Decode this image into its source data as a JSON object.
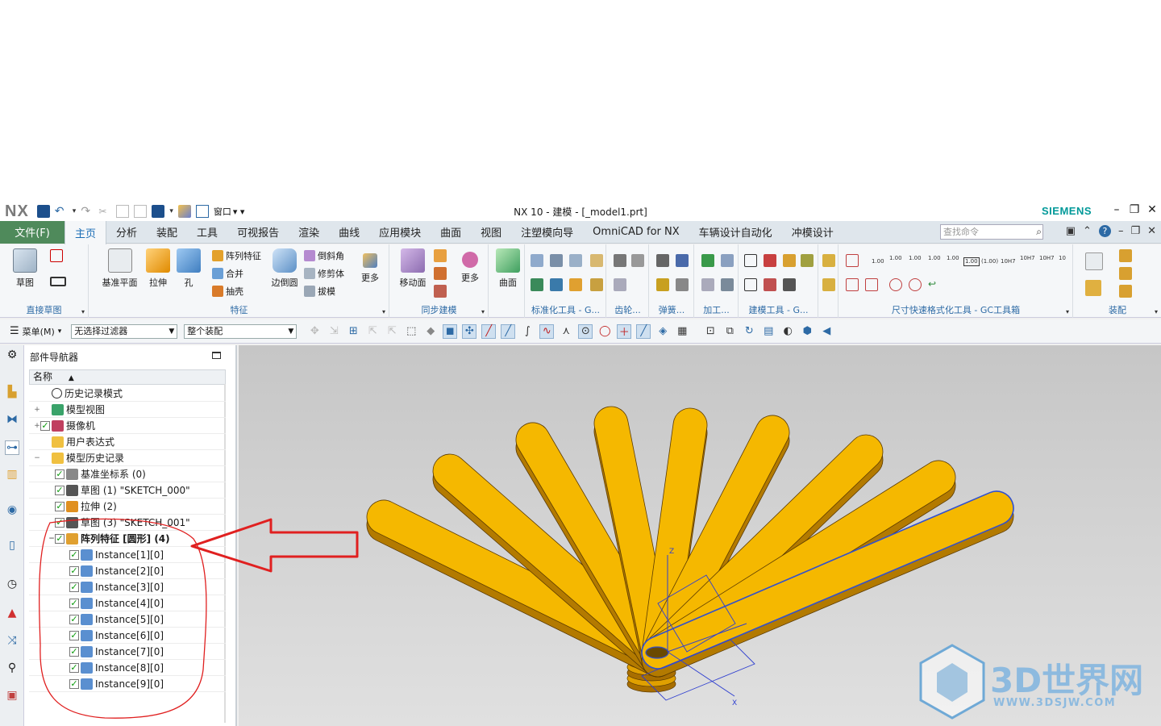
{
  "app": {
    "logo": "NX",
    "window_menu_label": "窗口",
    "title": "NX 10 - 建模 - [_model1.prt]",
    "brand": "SIEMENS"
  },
  "tabs": {
    "file": "文件(F)",
    "items": [
      "主页",
      "分析",
      "装配",
      "工具",
      "可视报告",
      "渲染",
      "曲线",
      "应用模块",
      "曲面",
      "视图",
      "注塑模向导",
      "OmniCAD for NX",
      "车辆设计自动化",
      "冲模设计"
    ],
    "active": "主页",
    "search_placeholder": "查找命令"
  },
  "ribbon": {
    "sketch": {
      "label": "草图",
      "group": "直接草图"
    },
    "feature": {
      "datum_plane": "基准平面",
      "extrude": "拉伸",
      "hole": "孔",
      "pattern": "阵列特征",
      "unite": "合并",
      "shell": "抽壳",
      "edge_blend": "边倒圆",
      "chamfer": "倒斜角",
      "trim_body": "修剪体",
      "draft": "拔模",
      "more": "更多",
      "group": "特征"
    },
    "sync": {
      "move_face": "移动面",
      "more": "更多",
      "group": "同步建模"
    },
    "surface": {
      "label": "曲面"
    },
    "groups": {
      "std_tools": "标准化工具 - G...",
      "gear": "齿轮...",
      "spring": "弹簧...",
      "machining": "加工...",
      "modeling_tools": "建模工具 - G...",
      "dim": "尺寸快速格式化工具 - GC工具箱",
      "assembly": "装配"
    },
    "tolerance_labels": [
      "1.00",
      "1.00",
      "1.00",
      "1.00",
      "1.00",
      "1.00",
      "(1.00)",
      "10H7",
      "10H7",
      "10H7",
      "10"
    ]
  },
  "toolbar2": {
    "menu": "菜单(M)",
    "filter": "无选择过滤器",
    "scope": "整个装配"
  },
  "navigator": {
    "title": "部件导航器",
    "column": "名称",
    "rows": [
      {
        "label": "历史记录模式",
        "indent": 0,
        "check": false,
        "icon": "clock-icon"
      },
      {
        "label": "模型视图",
        "indent": 0,
        "check": false,
        "icon": "view-icon",
        "expander": "+"
      },
      {
        "label": "摄像机",
        "indent": 0,
        "check": true,
        "icon": "camera-icon",
        "expander": "+"
      },
      {
        "label": "用户表达式",
        "indent": 0,
        "check": false,
        "icon": "folder-icon"
      },
      {
        "label": "模型历史记录",
        "indent": 0,
        "check": false,
        "icon": "folder-icon",
        "expander": "−"
      },
      {
        "label": "基准坐标系 (0)",
        "indent": 1,
        "check": true,
        "icon": "csys-icon"
      },
      {
        "label": "草图 (1) \"SKETCH_000\"",
        "indent": 1,
        "check": true,
        "icon": "sketch-icon"
      },
      {
        "label": "拉伸 (2)",
        "indent": 1,
        "check": true,
        "icon": "extrude-icon"
      },
      {
        "label": "草图 (3) \"SKETCH_001\"",
        "indent": 1,
        "check": true,
        "icon": "sketch-icon"
      },
      {
        "label": "阵列特征 [圆形] (4)",
        "indent": 1,
        "check": true,
        "icon": "pattern-icon",
        "bold": true,
        "expander": "−"
      },
      {
        "label": "Instance[1][0]",
        "indent": 2,
        "check": true,
        "icon": "instance-icon"
      },
      {
        "label": "Instance[2][0]",
        "indent": 2,
        "check": true,
        "icon": "instance-icon"
      },
      {
        "label": "Instance[3][0]",
        "indent": 2,
        "check": true,
        "icon": "instance-icon"
      },
      {
        "label": "Instance[4][0]",
        "indent": 2,
        "check": true,
        "icon": "instance-icon"
      },
      {
        "label": "Instance[5][0]",
        "indent": 2,
        "check": true,
        "icon": "instance-icon"
      },
      {
        "label": "Instance[6][0]",
        "indent": 2,
        "check": true,
        "icon": "instance-icon"
      },
      {
        "label": "Instance[7][0]",
        "indent": 2,
        "check": true,
        "icon": "instance-icon"
      },
      {
        "label": "Instance[8][0]",
        "indent": 2,
        "check": true,
        "icon": "instance-icon"
      },
      {
        "label": "Instance[9][0]",
        "indent": 2,
        "check": true,
        "icon": "instance-icon"
      }
    ]
  },
  "viewport": {
    "axis_z": "Z",
    "axis_x": "X",
    "part_color": "#f5b800",
    "edge_color": "#b37a00"
  },
  "watermark": {
    "text": "3D世界网",
    "url": "WWW.3DSJW.COM"
  },
  "colors": {
    "file_tab": "#4f8a5b",
    "group_label": "#2d6aa5",
    "annotation": "#e02020"
  }
}
